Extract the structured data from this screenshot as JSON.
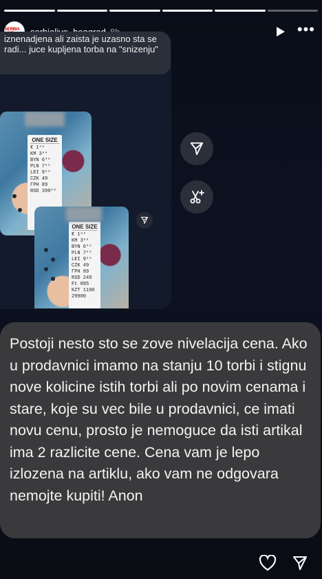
{
  "story": {
    "progress_segments": 6,
    "progress_done": 5,
    "avatar_text": "SERBIA LIVE",
    "username": "serbialive_beograd",
    "time_ago": "8h"
  },
  "quoted_message": {
    "text": "iznenadjena ali zaista je uzasno sta se radi... juce kupljena torba na \"snizenju\""
  },
  "tag1": {
    "size_label": "ONE SIZE",
    "lines": [
      "€        1⁹⁹",
      "KM       3⁹⁹",
      "BYN      6⁴⁹",
      "PLN      7⁹⁹",
      "LEI      9⁹⁹",
      "CZK       49",
      "ГРН       89",
      "RSD    399⁰⁰"
    ]
  },
  "tag2": {
    "size_label": "ONE SIZE",
    "lines": [
      "€        1⁹⁹",
      "KM       3⁹⁹",
      "BYN      6⁴⁹",
      "PLN      7⁹⁹",
      "LEI      9⁹⁹",
      "CZK       49",
      "ГРН       89",
      "RSD     249",
      "Ft       895",
      "KZT     1190",
      "       29900"
    ]
  },
  "caption": {
    "text": "Postoji nesto sto se zove nivelacija cena. Ako u prodavnici imamo na stanju 10 torbi i stignu nove kolicine istih torbi ali po novim cenama i stare, koje su vec bile u prodavnici, ce imati novu cenu, prosto je nemoguce da isti artikal ima 2 razlicite cene. Cena vam je lepo izlozena na artiklu, ako vam ne odgovara nemojte kupiti! Anon"
  },
  "icons": {
    "share": "send-icon",
    "sticker": "cut-sparkle-icon",
    "like": "heart-icon",
    "send": "send-icon"
  }
}
